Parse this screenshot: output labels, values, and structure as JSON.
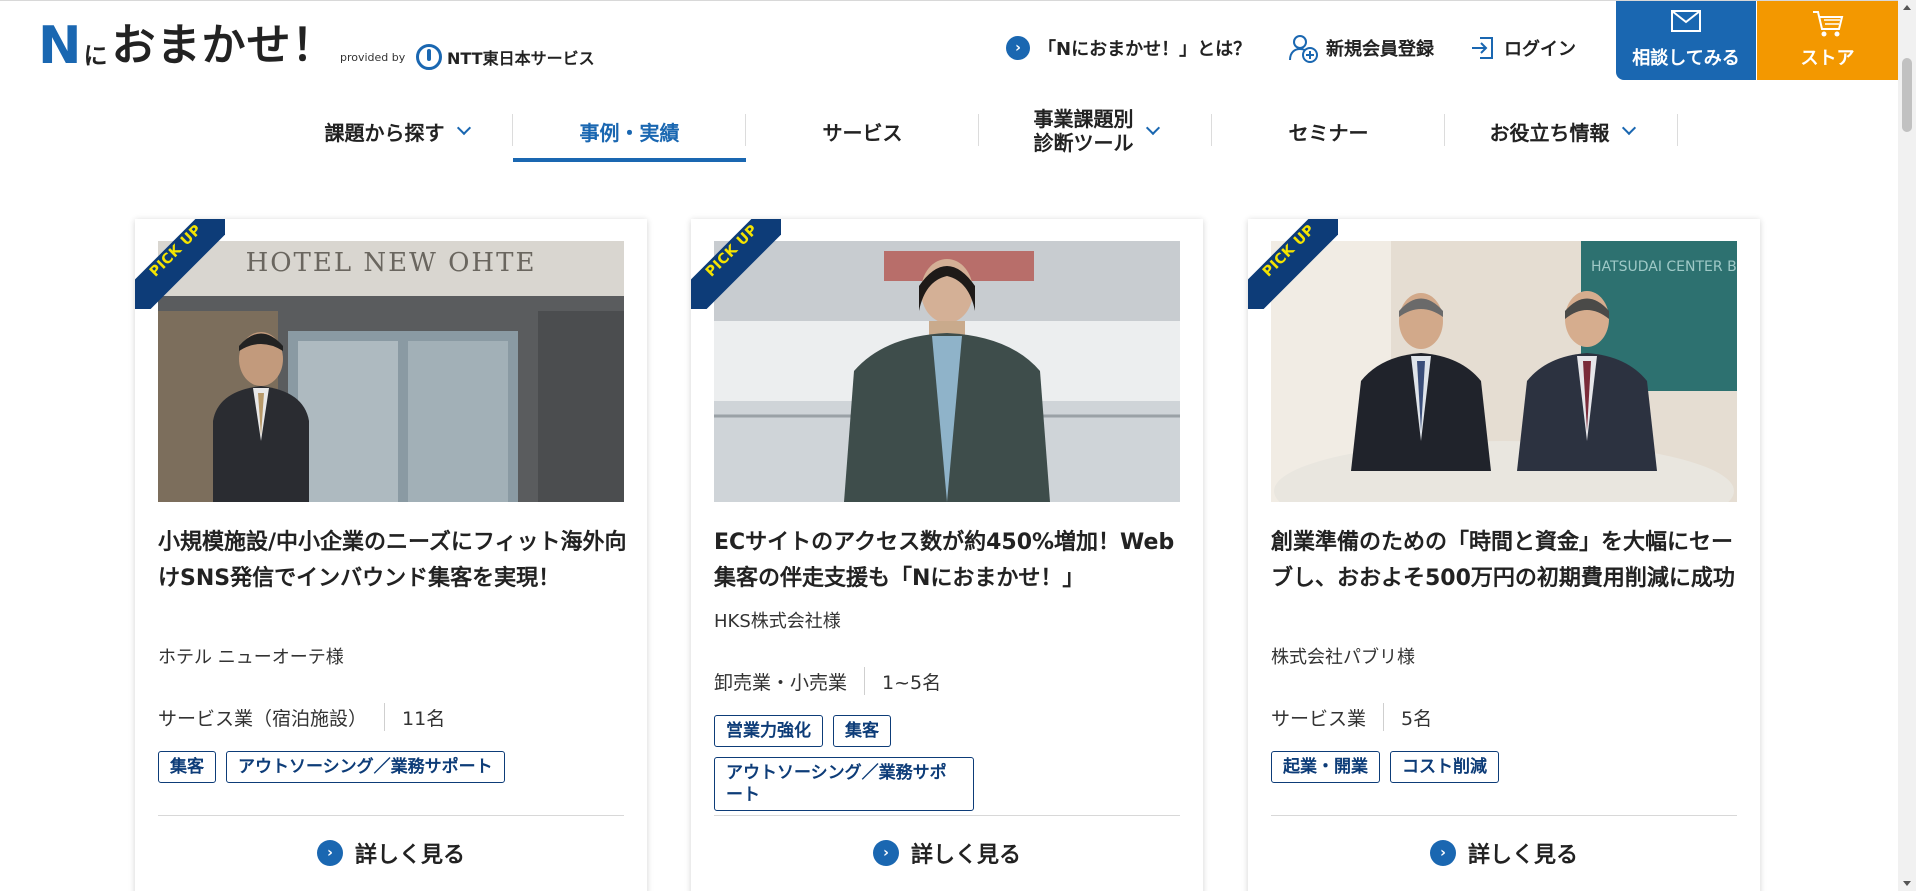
{
  "header": {
    "logo_n": "N",
    "logo_ni": "に",
    "logo_rest": "おまかせ！",
    "provided_by": "provided by",
    "company_name": "NTT東日本サービス",
    "about_link": "「Nにおまかせ！」とは？",
    "register_link": "新規会員登録",
    "login_link": "ログイン",
    "consult_button": "相談してみる",
    "store_button": "ストア"
  },
  "nav": {
    "items": [
      {
        "label": "課題から探す",
        "dropdown": true
      },
      {
        "label": "事例・実績",
        "active": true
      },
      {
        "label": "サービス"
      },
      {
        "label_line1": "事業課題別",
        "label_line2": "診断ツール",
        "dropdown": true
      },
      {
        "label": "セミナー"
      },
      {
        "label": "お役立ち情報",
        "dropdown": true
      }
    ]
  },
  "cards": [
    {
      "badge": "PICK UP",
      "title": "小規模施設/中小企業のニーズにフィット海外向けSNS発信でインバウンド集客を実現！",
      "company": "ホテル ニューオーテ様",
      "industry": "サービス業（宿泊施設）",
      "employees": "11名",
      "tags": [
        "集客",
        "アウトソーシング／業務サポート"
      ],
      "photo_sign": "HOTEL NEW OHTE",
      "more": "詳しく見る"
    },
    {
      "badge": "PICK UP",
      "title": "ECサイトのアクセス数が約450%増加！Web集客の伴走支援も「Nにおまかせ！」",
      "company": "HKS株式会社様",
      "industry": "卸売業・小売業",
      "employees": "1~5名",
      "tags": [
        "営業力強化",
        "集客",
        "アウトソーシング／業務サポート"
      ],
      "more": "詳しく見る"
    },
    {
      "badge": "PICK UP",
      "title": "創業準備のための「時間と資金」を大幅にセーブし、おおよそ500万円の初期費用削減に成功",
      "company": "株式会社パブリ様",
      "industry": "サービス業",
      "employees": "5名",
      "tags": [
        "起業・開業",
        "コスト削減"
      ],
      "photo_sign": "HATSUDAI CENTER BUILDING",
      "more": "詳しく見る"
    }
  ],
  "colors": {
    "brand_blue": "#1a67b1",
    "navy": "#0d3c78",
    "store_orange": "#f39800",
    "pickup_yellow": "#f5e400"
  }
}
